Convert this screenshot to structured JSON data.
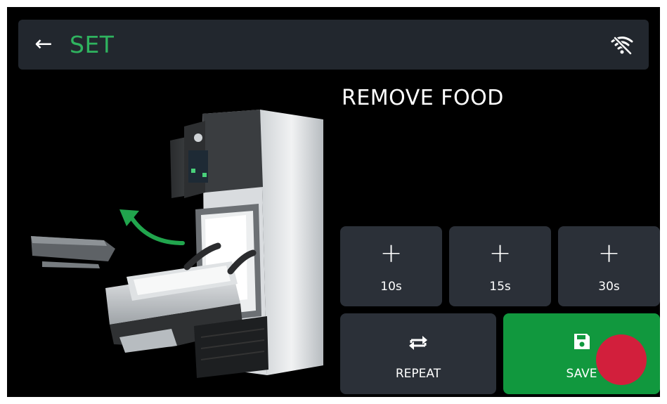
{
  "header": {
    "back_icon": "arrow-left-icon",
    "title": "SET",
    "wifi_icon": "wifi-off-icon"
  },
  "step": {
    "title": "REMOVE FOOD"
  },
  "image": {
    "subject": "oven-illustration"
  },
  "add_time_buttons": [
    {
      "icon": "plus-icon",
      "label": "10s"
    },
    {
      "icon": "plus-icon",
      "label": "15s"
    },
    {
      "icon": "plus-icon",
      "label": "30s"
    }
  ],
  "actions": {
    "repeat": {
      "icon": "repeat-icon",
      "label": "REPEAT"
    },
    "save": {
      "icon": "save-icon",
      "label": "SAVE"
    }
  },
  "colors": {
    "accent_green": "#2fb35f",
    "save_green": "#11983e",
    "panel": "#2b3038",
    "topbar": "#22272e",
    "record_red": "#d21f3c"
  }
}
